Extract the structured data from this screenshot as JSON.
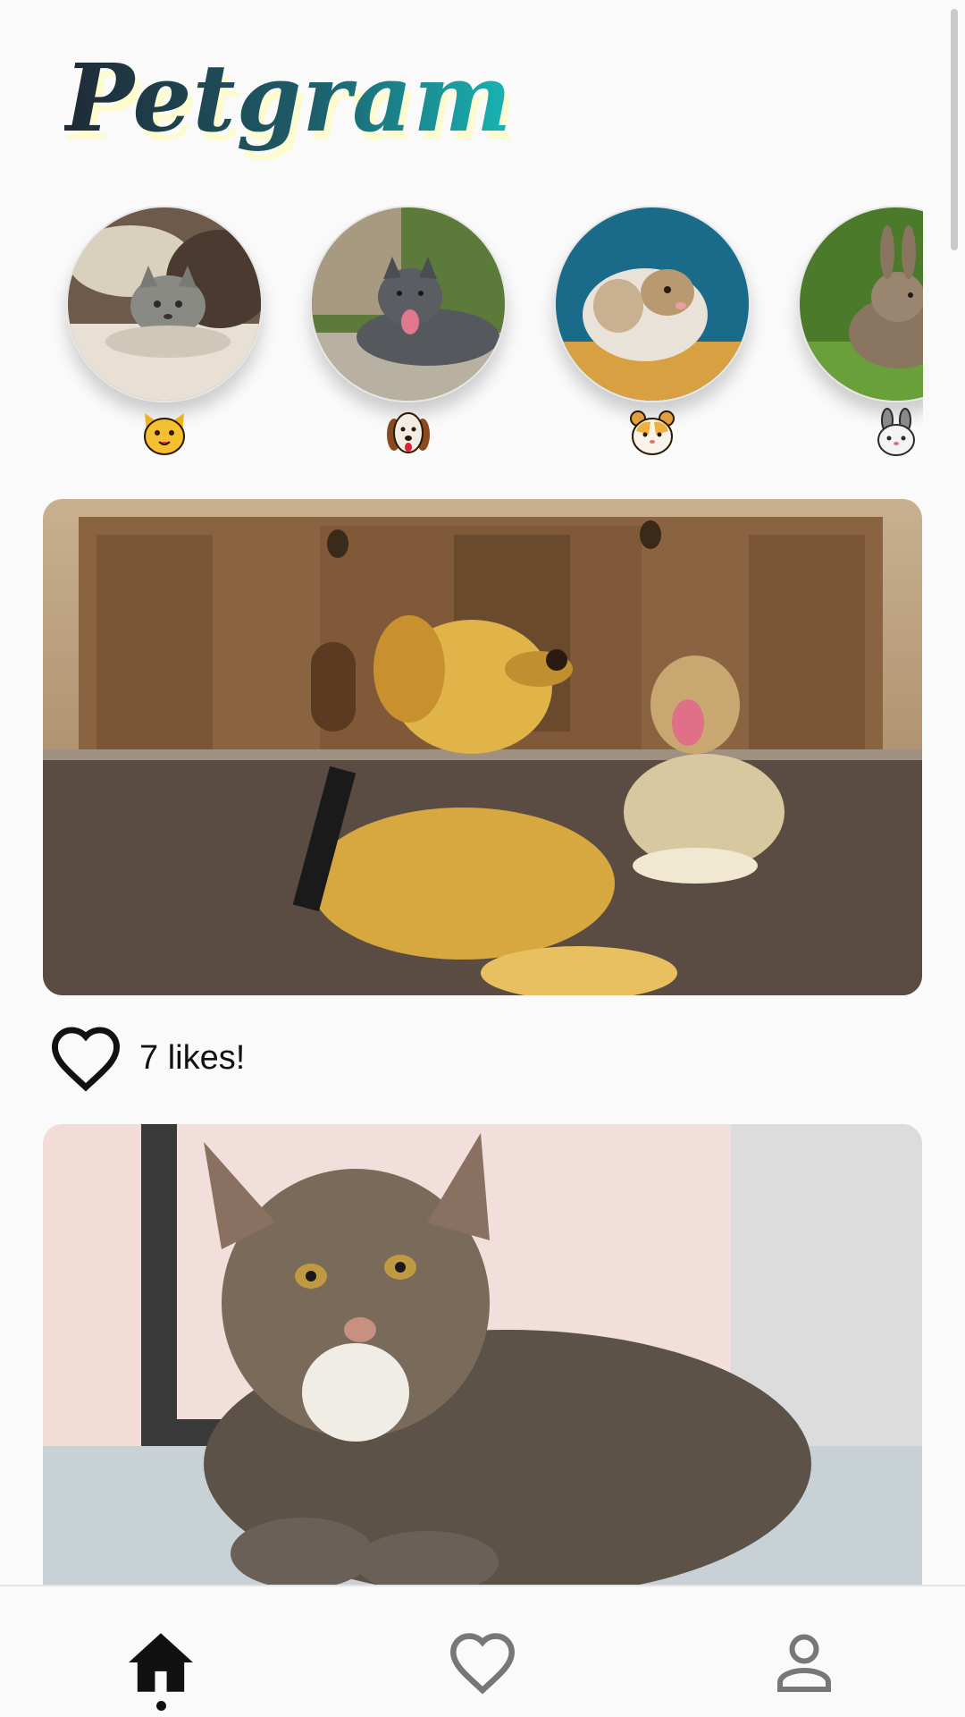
{
  "app": {
    "logo_text": "Petgram"
  },
  "categories": [
    {
      "name": "cat",
      "emoji_icon": "cat-face-icon"
    },
    {
      "name": "dog",
      "emoji_icon": "dog-face-icon"
    },
    {
      "name": "hamster",
      "emoji_icon": "hamster-face-icon"
    },
    {
      "name": "rabbit",
      "emoji_icon": "rabbit-face-icon"
    }
  ],
  "feed": [
    {
      "likes_text": "7 likes!",
      "like_icon": "heart-outline-icon"
    }
  ],
  "bottom_nav": {
    "items": [
      "home-icon",
      "heart-outline-icon",
      "user-icon"
    ],
    "active": "home"
  },
  "colors": {
    "logo_gradient_start": "#1f2a36",
    "logo_gradient_end": "#18b5b5",
    "background": "#fafafa"
  }
}
